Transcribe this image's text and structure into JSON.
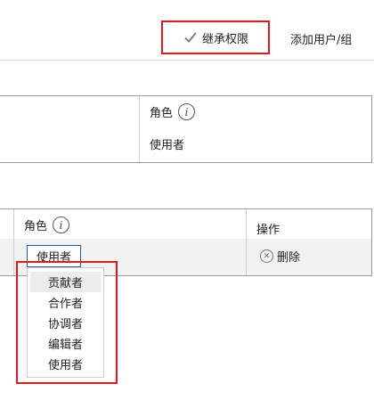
{
  "toolbar": {
    "inherit_label": "继承权限",
    "add_label": "添加用户/组"
  },
  "table1": {
    "role_header": "角色",
    "role_value": "使用者"
  },
  "table2": {
    "role_header": "角色",
    "ops_header": "操作",
    "selected_role": "使用者",
    "delete_label": "删除"
  },
  "dropdown": {
    "options": [
      "贡献者",
      "合作者",
      "协调者",
      "编辑者",
      "使用者"
    ],
    "highlighted_index": 0
  },
  "colors": {
    "highlight_border": "#e8151b",
    "select_border": "#2a5a9a"
  }
}
